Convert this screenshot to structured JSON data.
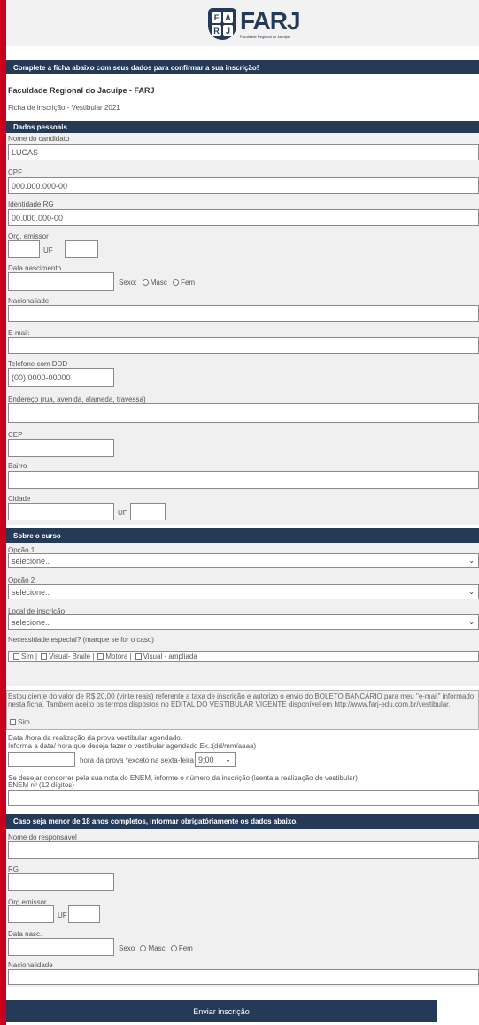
{
  "brand": {
    "monogram": [
      "F",
      "A",
      "R",
      "J"
    ],
    "name": "FARJ",
    "subtitle": "Faculdade Regional do Jacuipe"
  },
  "header": {
    "intro": "Complete a ficha abaixo com seus dados para confirmar a sua inscrição!",
    "institution": "Faculdade Regional do Jacuipe - FARJ",
    "form_title": "Ficha de inscrição - Vestibular 2021"
  },
  "personal": {
    "section_title": "Dados pessoais",
    "name_label": "Nome do candidato",
    "name_value": "LUCAS",
    "cpf_label": "CPF",
    "cpf_value": "000.000.000-00",
    "rg_label": "Identidade RG",
    "rg_value": "00.000.000-00",
    "org_label": "Org. emissor",
    "uf_label": "UF",
    "birth_label": "Data nascimento",
    "sex_label": "Sexo:",
    "sex_male": "Masc",
    "sex_female": "Fem",
    "nationality_label": "Nacionaliade",
    "email_label": "E-mail:",
    "phone_label": "Telefone com DDD",
    "phone_value": "(00) 0000-00000",
    "address_label": "Endereço (rua, avenida, alameda, travessa)",
    "cep_label": "CEP",
    "district_label": "Bairro",
    "city_label": "Cidade",
    "city_uf_label": "UF"
  },
  "course": {
    "section_title": "Sobre o curso",
    "option1_label": "Opção 1",
    "option1_value": "selecione..",
    "option2_label": "Opção 2",
    "option2_value": "selecione..",
    "location_label": "Local de inscrição",
    "location_value": "selecione..",
    "special_label": "Necessidade especial? (marque se for o caso)",
    "special_sim": "Sim |",
    "special_braile": "Visual- Braile |",
    "special_motora": "Motora |",
    "special_ampliada": "Visual - ampliada",
    "consent_text": "Estou ciente do valor de R$ 20,00 (vinte reais) referente a taxa de inscrição e autorizo o envio do BOLETO BANCÁRIO para meu \"e-mail\" informado nesta ficha. Tambem aceito os termos dispostos no EDITAL DO VESTIBULAR VIGENTE disponível em http://www.farj-edu.com.br/vestibular.",
    "consent_sim": "Sim",
    "exam_date_label1": "Data /hora da realização da prova vestibular agendado.",
    "exam_date_label2": "Informa a data/ hora que deseja fazer o vestibular agendado Ex.:(dd/mm/aaaa)",
    "exam_hour_label": "hora da prova *exceto na sexta-feira",
    "exam_hour_value": "9:00",
    "enem_label1": "Se desejar concorrer pela sua nota do ENEM, informe o número da inscrição (isenta a realização do vestibular)",
    "enem_label2": "ENEM nº (12 dígitos)"
  },
  "guardian": {
    "section_title": "Caso seja menor de 18 anos completos, informar obrigatóriamente os dados abaixo.",
    "name_label": "Nome do responsável",
    "rg_label": "RG",
    "org_label": "Org emissor",
    "uf_label": "UF",
    "birth_label": "Data nasc.",
    "sex_label": "Sexo",
    "sex_male": "Masc",
    "sex_female": "Fem",
    "nationality_label": "Nacionalidade"
  },
  "submit_label": "Enviar inscrição",
  "icons": {
    "chevron": "chevron-down-icon",
    "logo": "farj-shield-logo"
  },
  "colors": {
    "navy": "#243a57",
    "red_border": "#c8001e",
    "panel": "#f0f0f0"
  }
}
